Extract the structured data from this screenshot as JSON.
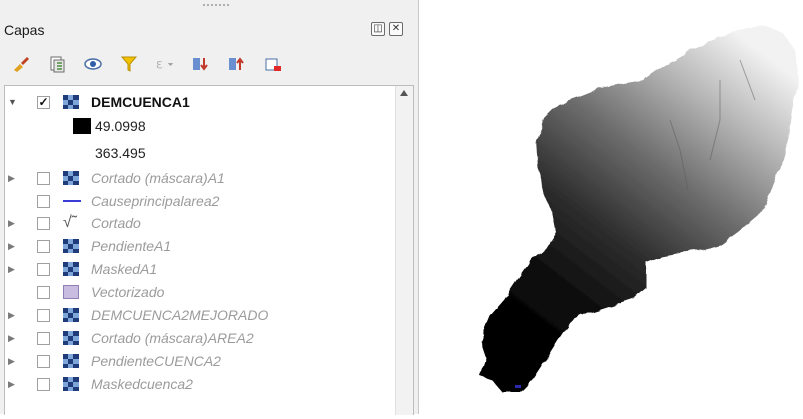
{
  "panel": {
    "title": "Capas",
    "float_icon": "float-window-icon",
    "close_icon": "close-icon"
  },
  "toolbar": [
    {
      "name": "style-brush-icon",
      "glyph": "🖌"
    },
    {
      "name": "add-group-icon",
      "glyph": "▦"
    },
    {
      "name": "visibility-eye-icon",
      "glyph": "👁"
    },
    {
      "name": "filter-icon",
      "glyph": "▼"
    },
    {
      "name": "expression-filter-icon",
      "glyph": "ε"
    },
    {
      "name": "expand-all-icon",
      "glyph": "⇊"
    },
    {
      "name": "collapse-all-icon",
      "glyph": "⇈"
    },
    {
      "name": "remove-layer-icon",
      "glyph": "▭"
    }
  ],
  "layers": {
    "active": {
      "name": "DEMCUENCA1",
      "checked": true,
      "expanded": true
    },
    "legend_min": "49.0998",
    "legend_max": "363.495",
    "items": [
      {
        "name": "Cortado (máscara)A1",
        "type": "raster",
        "expander": true
      },
      {
        "name": "Causeprincipalarea2",
        "type": "line",
        "expander": false
      },
      {
        "name": "Cortado",
        "type": "cut",
        "expander": true
      },
      {
        "name": "PendienteA1",
        "type": "raster",
        "expander": true
      },
      {
        "name": "MaskedA1",
        "type": "raster",
        "expander": true
      },
      {
        "name": "Vectorizado",
        "type": "polygon",
        "expander": false
      },
      {
        "name": "DEMCUENCA2MEJORADO",
        "type": "raster",
        "expander": true
      },
      {
        "name": "Cortado (máscara)AREA2",
        "type": "raster",
        "expander": true
      },
      {
        "name": "PendienteCUENCA2",
        "type": "raster",
        "expander": true
      },
      {
        "name": "Maskedcuenca2",
        "type": "raster",
        "expander": true
      }
    ]
  },
  "colors": {
    "line_layer": "#3b3bd6",
    "polygon_layer": "#c8bce0"
  }
}
